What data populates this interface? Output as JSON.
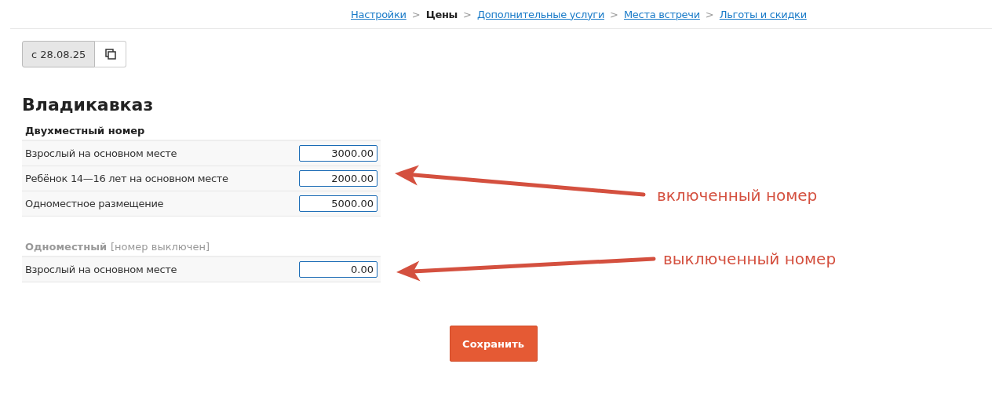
{
  "breadcrumbs": [
    {
      "label": "Настройки",
      "selected": false
    },
    {
      "label": "Цены",
      "selected": true
    },
    {
      "label": "Дополнительные услуги",
      "selected": false
    },
    {
      "label": "Места встречи",
      "selected": false
    },
    {
      "label": "Льготы и скидки",
      "selected": false
    }
  ],
  "breadcrumb_separator": ">",
  "date_button": {
    "label": "с 28.08.25",
    "selected": true
  },
  "city": "Владикавказ",
  "room_groups": [
    {
      "name": "Двухместный номер",
      "enabled": true,
      "rows": [
        {
          "label": "Взрослый на основном месте",
          "value": "3000.00"
        },
        {
          "label": "Ребёнок 14—16 лет на основном месте",
          "value": "2000.00"
        },
        {
          "label": "Одноместное размещение",
          "value": "5000.00"
        }
      ]
    },
    {
      "name": "Одноместный",
      "enabled": false,
      "status_note": "[номер выключен]",
      "rows": [
        {
          "label": "Взрослый на основном месте",
          "value": "0.00"
        }
      ]
    }
  ],
  "save_button": "Сохранить",
  "annotations": [
    {
      "text": "включенный номер"
    },
    {
      "text": "выключенный номер"
    }
  ]
}
